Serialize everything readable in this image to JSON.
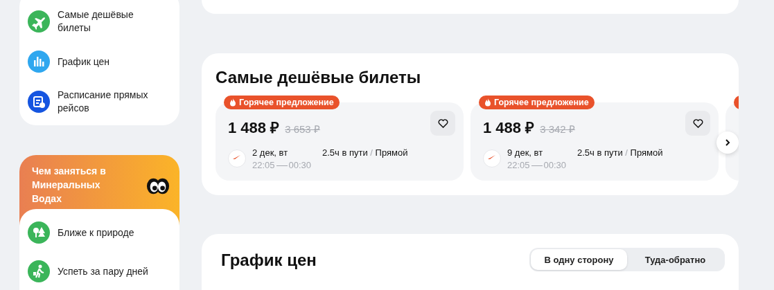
{
  "sidebar": {
    "items": [
      {
        "label": "Самые дешёвые билеты",
        "kind": "plane"
      },
      {
        "label": "График цен",
        "kind": "chart"
      },
      {
        "label": "Расписание прямых рейсов",
        "kind": "schedule"
      }
    ]
  },
  "activities": {
    "title": "Чем заняться в Минеральных Водах",
    "items": [
      {
        "label": "Ближе к природе",
        "kind": "trees"
      },
      {
        "label": "Успеть за пару дней",
        "kind": "walker"
      }
    ]
  },
  "cheapest": {
    "title": "Самые дешёвые билеты",
    "tickets": [
      {
        "badge": "Горячее предложение",
        "price": "1 488 ₽",
        "old_price": "3 653 ₽",
        "date": "2 дек, вт",
        "depart": "22:05",
        "arrive": "00:30",
        "duration": "2.5ч в пути",
        "separator": "/",
        "stops": "Прямой",
        "favorite": false
      },
      {
        "badge": "Горячее предложение",
        "price": "1 488 ₽",
        "old_price": "3 342 ₽",
        "date": "9 дек, вт",
        "depart": "22:05",
        "arrive": "00:30",
        "duration": "2.5ч в пути",
        "separator": "/",
        "stops": "Прямой",
        "favorite": false
      }
    ],
    "partial_ticket": {
      "hot": true
    }
  },
  "price_chart": {
    "title": "График цен",
    "modes": [
      {
        "label": "В одну сторону",
        "selected": true
      },
      {
        "label": "Туда-обратно",
        "selected": false
      }
    ]
  }
}
